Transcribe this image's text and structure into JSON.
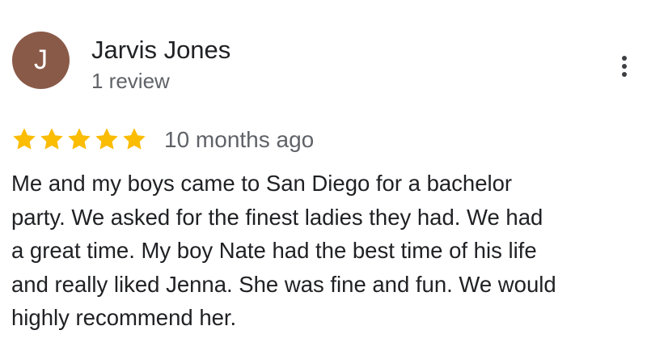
{
  "review": {
    "avatar_initial": "J",
    "avatar_color": "#8a5a48",
    "reviewer_name": "Jarvis Jones",
    "review_count": "1 review",
    "more_icon": "more-vertical-icon",
    "rating": 5,
    "rating_max": 5,
    "star_color": "#fbbc04",
    "timestamp": "10 months ago",
    "text": "Me and my boys came to  San Diego for a bachelor\nparty. We asked for the finest ladies they had. We had\na great time. My boy Nate had the best time of his life\nand really liked Jenna. She was fine and fun. We would\nhighly recommend her."
  }
}
